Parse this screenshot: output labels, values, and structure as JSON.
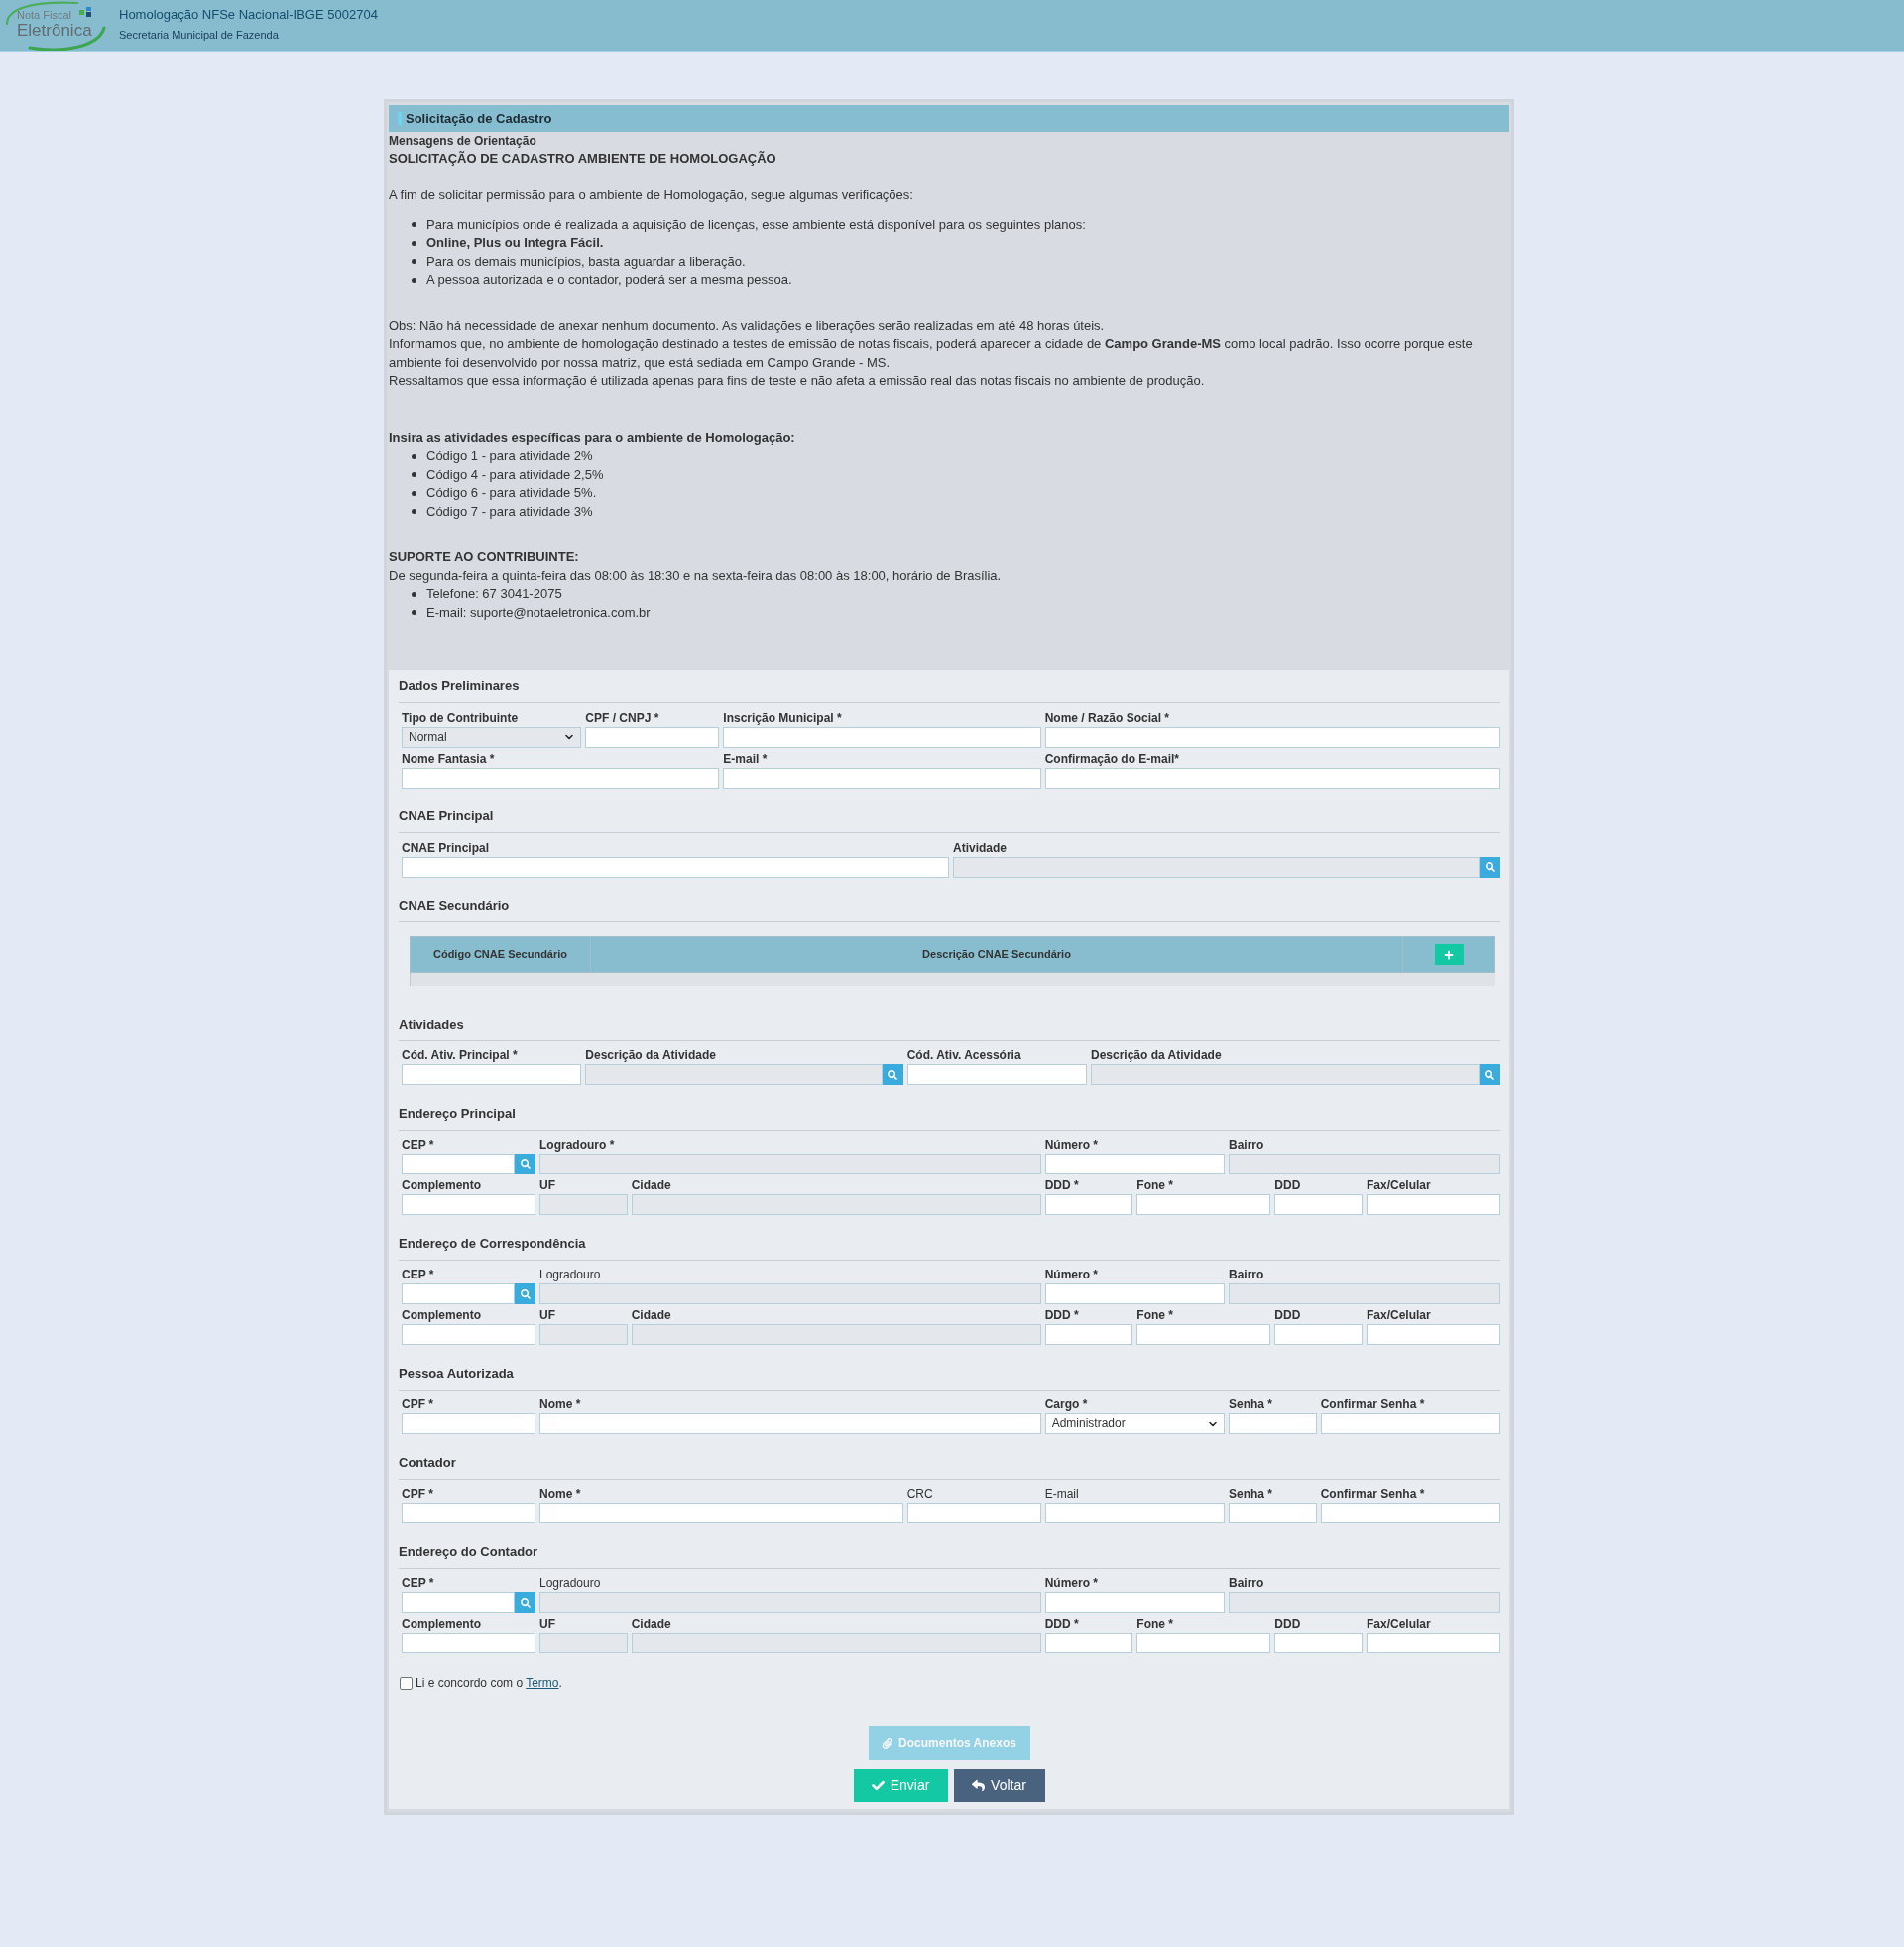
{
  "header": {
    "logo_top": "Nota Fiscal",
    "logo_bottom": "Eletrônica",
    "title": "Homologação NFSe Nacional-IBGE 5002704",
    "subtitle": "Secretaria Municipal de Fazenda"
  },
  "panel": {
    "title": "Solicitação de Cadastro"
  },
  "messages": {
    "subtitle": "Mensagens de Orientação",
    "heading": "SOLICITAÇÃO DE CADASTRO AMBIENTE DE HOMOLOGAÇÃO",
    "intro": "A fim de solicitar permissão para o ambiente de Homologação, segue algumas verificações:",
    "plans": [
      {
        "text": "Para municípios onde é realizada a aquisição de licenças, esse ambiente está disponível para os seguintes planos:",
        "bold": false
      },
      {
        "text": "Online, Plus ou Integra Fácil.",
        "bold": true
      },
      {
        "text": "Para os demais municípios, basta aguardar a liberação.",
        "bold": false
      },
      {
        "text": "A pessoa autorizada e o contador, poderá ser a mesma pessoa.",
        "bold": false
      }
    ],
    "notes": [
      "Obs: Não há necessidade de anexar nenhum documento. As validações e liberações serão realizadas em até 48 horas úteis.",
      "Informamos que, no ambiente de homologação destinado a testes de emissão de notas fiscais, poderá aparecer a cidade de **Campo Grande-MS** como local padrão. Isso ocorre porque este ambiente foi desenvolvido por nossa matriz, que está sediada em Campo Grande - MS.",
      "Ressaltamos que essa informação é utilizada apenas para fins de teste e não afeta a emissão real das notas fiscais no ambiente de produção."
    ],
    "activities_title": "Insira as atividades específicas para o ambiente de Homologação:",
    "activities": [
      "Código 1 - para atividade 2%",
      "Código 4 - para atividade 2,5%",
      "Código 6 - para atividade 5%.",
      "Código 7 - para atividade 3%"
    ],
    "support_title": "SUPORTE AO CONTRIBUINTE:",
    "support_hours": "De segunda-feira a quinta-feira das 08:00 às 18:30 e na sexta-feira das 08:00 às 18:00, horário de Brasília.",
    "contacts": [
      "Telefone: 67 3041-2075",
      "E-mail: suporte@notaeletronica.com.br"
    ]
  },
  "sections": [
    {
      "title": "Dados Preliminares",
      "kind": "fields",
      "fields": [
        {
          "label": "Tipo de Contribuinte",
          "bold": true,
          "kind": "select",
          "disabled": true,
          "value": "Normal"
        },
        {
          "label": "CPF / CNPJ *",
          "bold": true,
          "kind": "input",
          "disabled": false
        },
        {
          "label": "Inscrição Municipal *",
          "bold": true,
          "kind": "input",
          "disabled": false
        },
        {
          "label": "Nome / Razão Social *",
          "bold": true,
          "kind": "input",
          "disabled": false
        },
        {
          "label": "Nome Fantasia *",
          "bold": true,
          "kind": "input",
          "disabled": false
        },
        {
          "label": "E-mail *",
          "bold": true,
          "kind": "input",
          "disabled": false
        },
        {
          "label": "Confirmação do E-mail*",
          "bold": true,
          "kind": "input",
          "disabled": false
        }
      ]
    },
    {
      "title": "CNAE Principal",
      "kind": "fields",
      "fields": [
        {
          "label": "CNAE Principal",
          "bold": true,
          "kind": "input",
          "disabled": false
        },
        {
          "label": "Atividade",
          "bold": true,
          "kind": "lookup",
          "disabled": true
        }
      ]
    },
    {
      "title": "CNAE Secundário",
      "kind": "table",
      "columns": [
        "Código CNAE Secundário",
        "Descrição CNAE Secundário"
      ]
    },
    {
      "title": "Atividades",
      "kind": "fields",
      "fields": [
        {
          "label": "Cód. Ativ. Principal *",
          "bold": true,
          "kind": "input",
          "disabled": false
        },
        {
          "label": "Descrição da Atividade",
          "bold": true,
          "kind": "lookup",
          "disabled": true
        },
        {
          "label": "Cód. Ativ. Acessória",
          "bold": true,
          "kind": "input",
          "disabled": false
        },
        {
          "label": "Descrição da Atividade",
          "bold": true,
          "kind": "lookup",
          "disabled": true
        }
      ]
    },
    {
      "title": "Endereço Principal",
      "kind": "fields",
      "fields": [
        {
          "label": "CEP *",
          "bold": true,
          "kind": "lookup",
          "disabled": false
        },
        {
          "label": "Logradouro *",
          "bold": true,
          "kind": "input",
          "disabled": true
        },
        {
          "label": "Número *",
          "bold": true,
          "kind": "input",
          "disabled": false
        },
        {
          "label": "Bairro",
          "bold": true,
          "kind": "input",
          "disabled": true
        },
        {
          "label": "Complemento",
          "bold": true,
          "kind": "input",
          "disabled": false
        },
        {
          "label": "UF",
          "bold": true,
          "kind": "input",
          "disabled": true
        },
        {
          "label": "Cidade",
          "bold": true,
          "kind": "input",
          "disabled": true
        },
        {
          "label": "DDD *",
          "bold": true,
          "kind": "input",
          "disabled": false
        },
        {
          "label": "Fone *",
          "bold": true,
          "kind": "input",
          "disabled": false
        },
        {
          "label": "DDD",
          "bold": true,
          "kind": "input",
          "disabled": false
        },
        {
          "label": "Fax/Celular",
          "bold": true,
          "kind": "input",
          "disabled": false
        }
      ]
    },
    {
      "title": "Endereço de Correspondência",
      "kind": "fields",
      "fields": [
        {
          "label": "CEP *",
          "bold": true,
          "kind": "lookup",
          "disabled": false
        },
        {
          "label": "Logradouro",
          "bold": false,
          "kind": "input",
          "disabled": true
        },
        {
          "label": "Número *",
          "bold": true,
          "kind": "input",
          "disabled": false
        },
        {
          "label": "Bairro",
          "bold": true,
          "kind": "input",
          "disabled": true
        },
        {
          "label": "Complemento",
          "bold": true,
          "kind": "input",
          "disabled": false
        },
        {
          "label": "UF",
          "bold": true,
          "kind": "input",
          "disabled": true
        },
        {
          "label": "Cidade",
          "bold": true,
          "kind": "input",
          "disabled": true
        },
        {
          "label": "DDD *",
          "bold": true,
          "kind": "input",
          "disabled": false
        },
        {
          "label": "Fone *",
          "bold": true,
          "kind": "input",
          "disabled": false
        },
        {
          "label": "DDD",
          "bold": true,
          "kind": "input",
          "disabled": false
        },
        {
          "label": "Fax/Celular",
          "bold": true,
          "kind": "input",
          "disabled": false
        }
      ]
    },
    {
      "title": "Pessoa Autorizada",
      "kind": "fields",
      "fields": [
        {
          "label": "CPF *",
          "bold": true,
          "kind": "input",
          "disabled": false
        },
        {
          "label": "Nome *",
          "bold": true,
          "kind": "input",
          "disabled": false
        },
        {
          "label": "Cargo *",
          "bold": true,
          "kind": "select",
          "disabled": false,
          "value": "Administrador"
        },
        {
          "label": "Senha *",
          "bold": true,
          "kind": "input",
          "disabled": false
        },
        {
          "label": "Confirmar Senha *",
          "bold": true,
          "kind": "input",
          "disabled": false
        }
      ]
    },
    {
      "title": "Contador",
      "kind": "fields",
      "fields": [
        {
          "label": "CPF *",
          "bold": true,
          "kind": "input",
          "disabled": false
        },
        {
          "label": "Nome *",
          "bold": true,
          "kind": "input",
          "disabled": false
        },
        {
          "label": "CRC",
          "bold": false,
          "kind": "input",
          "disabled": false
        },
        {
          "label": "E-mail",
          "bold": false,
          "kind": "input",
          "disabled": false
        },
        {
          "label": "Senha *",
          "bold": true,
          "kind": "input",
          "disabled": false
        },
        {
          "label": "Confirmar Senha *",
          "bold": true,
          "kind": "input",
          "disabled": false
        }
      ]
    },
    {
      "title": "Endereço do Contador",
      "kind": "fields",
      "fields": [
        {
          "label": "CEP *",
          "bold": true,
          "kind": "lookup",
          "disabled": false
        },
        {
          "label": "Logradouro",
          "bold": false,
          "kind": "input",
          "disabled": true
        },
        {
          "label": "Número *",
          "bold": true,
          "kind": "input",
          "disabled": false
        },
        {
          "label": "Bairro",
          "bold": true,
          "kind": "input",
          "disabled": true
        },
        {
          "label": "Complemento",
          "bold": true,
          "kind": "input",
          "disabled": false
        },
        {
          "label": "UF",
          "bold": true,
          "kind": "input",
          "disabled": true
        },
        {
          "label": "Cidade",
          "bold": true,
          "kind": "input",
          "disabled": true
        },
        {
          "label": "DDD *",
          "bold": true,
          "kind": "input",
          "disabled": false
        },
        {
          "label": "Fone *",
          "bold": true,
          "kind": "input",
          "disabled": false
        },
        {
          "label": "DDD",
          "bold": true,
          "kind": "input",
          "disabled": false
        },
        {
          "label": "Fax/Celular",
          "bold": true,
          "kind": "input",
          "disabled": false
        }
      ]
    }
  ],
  "agreement": {
    "checked": false,
    "text": "Li e concordo com o",
    "link": "Termo",
    "suffix": "."
  },
  "attach_button": {
    "label": "Documentos Anexos",
    "disabled": true
  },
  "actions": [
    {
      "label": "Enviar",
      "kind": "submit"
    },
    {
      "label": "Voltar",
      "kind": "back"
    }
  ]
}
